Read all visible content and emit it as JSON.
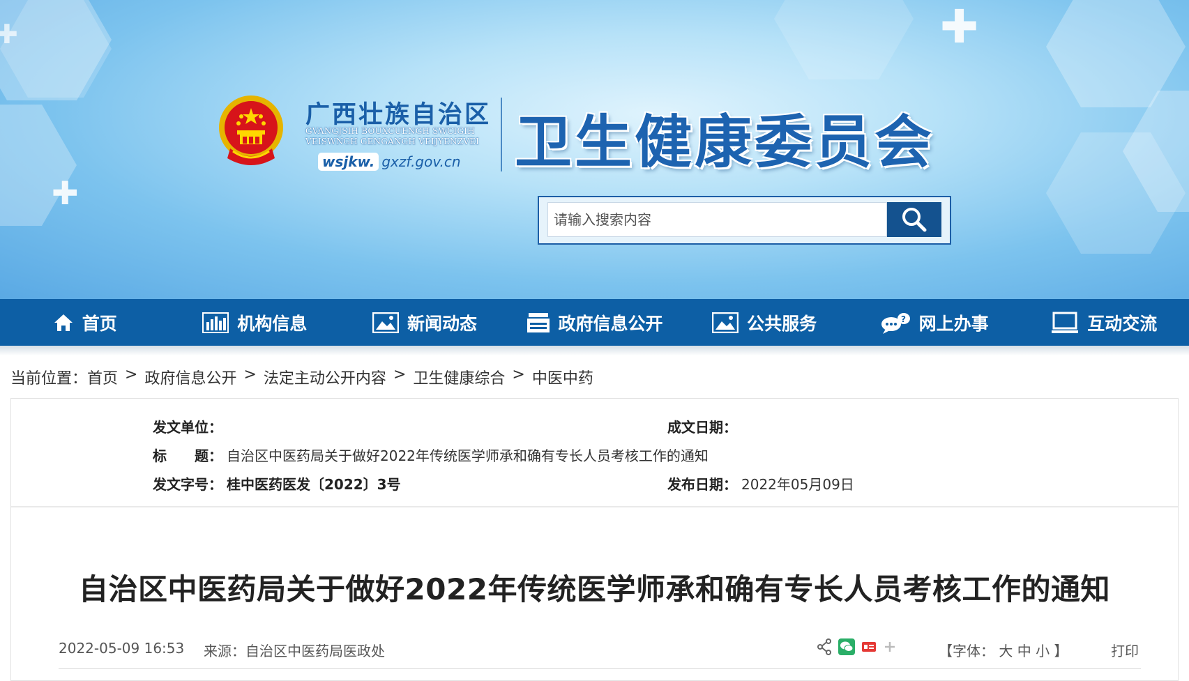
{
  "header": {
    "org_cn": "广西壮族自治区",
    "org_zhuang_line1": "GVANGJSIH BOUXCUENGH SWCIGIH",
    "org_zhuang_line2": "VEISWNGH GENGANGH VEIJYENZVEI",
    "domain_part1": "wsjkw.",
    "domain_part2": "gxzf.gov.cn",
    "commission": "卫生健康委员会",
    "search_placeholder": "请输入搜索内容"
  },
  "nav": [
    {
      "label": "首页",
      "icon": "home-icon"
    },
    {
      "label": "机构信息",
      "icon": "bar-chart-icon"
    },
    {
      "label": "新闻动态",
      "icon": "image-icon"
    },
    {
      "label": "政府信息公开",
      "icon": "document-stack-icon"
    },
    {
      "label": "公共服务",
      "icon": "picture-icon"
    },
    {
      "label": "网上办事",
      "icon": "chat-bubble-icon"
    },
    {
      "label": "互动交流",
      "icon": "monitor-icon"
    }
  ],
  "breadcrumb": {
    "prefix": "当前位置：",
    "items": [
      "首页",
      "政府信息公开",
      "法定主动公开内容",
      "卫生健康综合",
      "中医中药"
    ],
    "separator": ">"
  },
  "meta": {
    "issuer_label": "发文单位：",
    "issuer_value": "",
    "date_written_label": "成文日期：",
    "date_written_value": "",
    "title_label": "标　　题：",
    "title_value": "自治区中医药局关于做好2022年传统医学师承和确有专长人员考核工作的通知",
    "doc_no_label": "发文字号：",
    "doc_no_value": "桂中医药医发〔2022〕3号",
    "publish_label": "发布日期：",
    "publish_value": "2022年05月09日"
  },
  "article": {
    "title": "自治区中医药局关于做好2022年传统医学师承和确有专长人员考核工作的通知",
    "datetime": "2022-05-09 16:53",
    "source": "来源：自治区中医药局医政处",
    "font_prefix": "【字体：",
    "font_large": "大",
    "font_medium": "中",
    "font_small": "小",
    "font_suffix": "】",
    "print": "打印"
  },
  "colors": {
    "nav_bg": "#0d5fa5",
    "brand_blue": "#1d63b0",
    "search_button": "#14528f"
  }
}
